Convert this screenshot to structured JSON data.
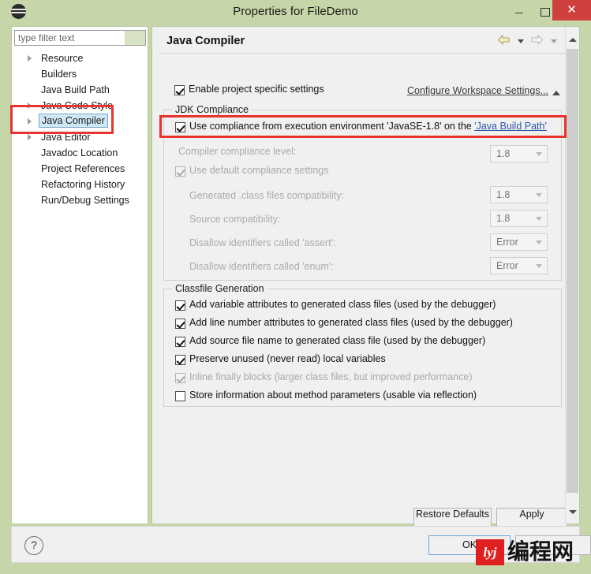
{
  "window": {
    "title": "Properties for FileDemo",
    "app_icon": "eclipse-icon",
    "minimize_label": "",
    "maximize_label": "",
    "close_label": "✕"
  },
  "sidebar": {
    "filter_placeholder": "type filter text",
    "filter_value": "",
    "items": [
      {
        "label": "Resource",
        "expandable": true,
        "selected": false
      },
      {
        "label": "Builders",
        "expandable": false,
        "selected": false
      },
      {
        "label": "Java Build Path",
        "expandable": false,
        "selected": false
      },
      {
        "label": "Java Code Style",
        "expandable": true,
        "selected": false
      },
      {
        "label": "Java Compiler",
        "expandable": true,
        "selected": true
      },
      {
        "label": "Java Editor",
        "expandable": true,
        "selected": false
      },
      {
        "label": "Javadoc Location",
        "expandable": false,
        "selected": false
      },
      {
        "label": "Project References",
        "expandable": false,
        "selected": false
      },
      {
        "label": "Refactoring History",
        "expandable": false,
        "selected": false
      },
      {
        "label": "Run/Debug Settings",
        "expandable": false,
        "selected": false
      }
    ]
  },
  "content": {
    "page_title": "Java Compiler",
    "nav": {
      "back_icon": "arrow-back-icon",
      "back_caret_icon": "chevron-down-icon",
      "forward_icon": "arrow-forward-icon",
      "forward_caret_icon": "chevron-down-icon",
      "menu_caret_icon": "chevron-down-icon"
    },
    "enable_project_specific": {
      "label": "Enable project specific settings",
      "checked": true
    },
    "configure_workspace_link": "Configure Workspace Settings...",
    "collapse_icon": "chevron-up-icon",
    "jdk_compliance": {
      "title": "JDK Compliance",
      "use_execution_env": {
        "prefix": "Use compliance from execution environment 'JavaSE-1.8' on the ",
        "link": "'Java Build Path'",
        "checked": true
      },
      "compliance_level": {
        "label": "Compiler compliance level:",
        "value": "1.8",
        "disabled": true
      },
      "use_default_settings": {
        "label": "Use default compliance settings",
        "checked": true,
        "disabled": true
      },
      "rows": [
        {
          "label": "Generated .class files compatibility:",
          "value": "1.8"
        },
        {
          "label": "Source compatibility:",
          "value": "1.8"
        },
        {
          "label": "Disallow identifiers called 'assert':",
          "value": "Error"
        },
        {
          "label": "Disallow identifiers called 'enum':",
          "value": "Error"
        }
      ]
    },
    "classfile_generation": {
      "title": "Classfile Generation",
      "options": [
        {
          "label": "Add variable attributes to generated class files (used by the debugger)",
          "checked": true,
          "disabled": false
        },
        {
          "label": "Add line number attributes to generated class files (used by the debugger)",
          "checked": true,
          "disabled": false
        },
        {
          "label": "Add source file name to generated class file (used by the debugger)",
          "checked": true,
          "disabled": false
        },
        {
          "label": "Preserve unused (never read) local variables",
          "checked": true,
          "disabled": false
        },
        {
          "label": "Inline finally blocks (larger class files, but improved performance)",
          "checked": true,
          "disabled": true
        },
        {
          "label": "Store information about method parameters (usable via reflection)",
          "checked": false,
          "disabled": false
        }
      ]
    },
    "restore_defaults_label": "Restore Defaults",
    "apply_label": "Apply"
  },
  "footer": {
    "help_icon": "question-mark-icon",
    "ok_label": "OK",
    "cancel_label": ""
  },
  "watermark": {
    "logo_text": "lyj",
    "text": "编程网"
  },
  "colors": {
    "window_chrome": "#c6d6a8",
    "close_button": "#d0403f",
    "panel_bg": "#f0f0f0",
    "selection": "#cfe8f6",
    "annotation_red": "#e8332f",
    "link_blue": "#2a55a8",
    "disabled_text": "#ababab"
  }
}
